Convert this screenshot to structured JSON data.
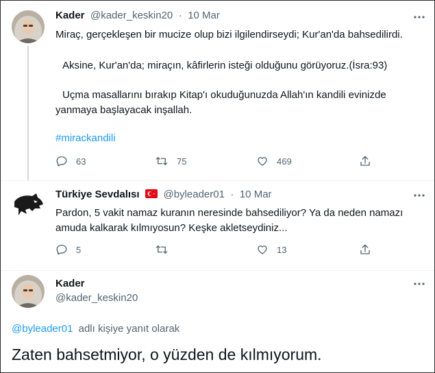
{
  "tweets": [
    {
      "name": "Kader",
      "handle": "@kader_keskin20",
      "separator": "·",
      "date": "10 Mar",
      "paragraphs": [
        "Miraç, gerçekleşen bir mucize olup bizi ilgilendirseydi; Kur'an'da bahsedilirdi.",
        "Aksine, Kur'an'da; miraçın, kâfirlerin isteği olduğunu görüyoruz.(İsra:93)",
        "Uçma masallarını bırakıp Kitap'ı okuduğunuzda Allah'ın kandili evinizde",
        "yanmaya başlayacak inşallah."
      ],
      "hashtag": "#mirackandili",
      "replies": "63",
      "retweets": "75",
      "likes": "469"
    },
    {
      "name": "Türkiye Sevdalısı",
      "handle": "@byleader01",
      "separator": "·",
      "date": "10 Mar",
      "lines": [
        "Pardon, 5 vakit namaz kuranın neresinde bahsediliyor? Ya da neden namazı",
        "amuda kalkarak kılmıyosun? Keşke akletseydiniz..."
      ],
      "replies": "5",
      "retweets": "",
      "likes": "13"
    },
    {
      "name": "Kader",
      "handle": "@kader_keskin20",
      "reply_to_handle": "@byleader01",
      "reply_to_suffix": "adlı kişiye yanıt olarak",
      "main_text": "Zaten bahsetmiyor, o yüzden de kılmıyorum."
    }
  ],
  "colors": {
    "accent": "#1d9bf0",
    "secondary_text": "#536471",
    "flag_red": "#e30a17"
  }
}
